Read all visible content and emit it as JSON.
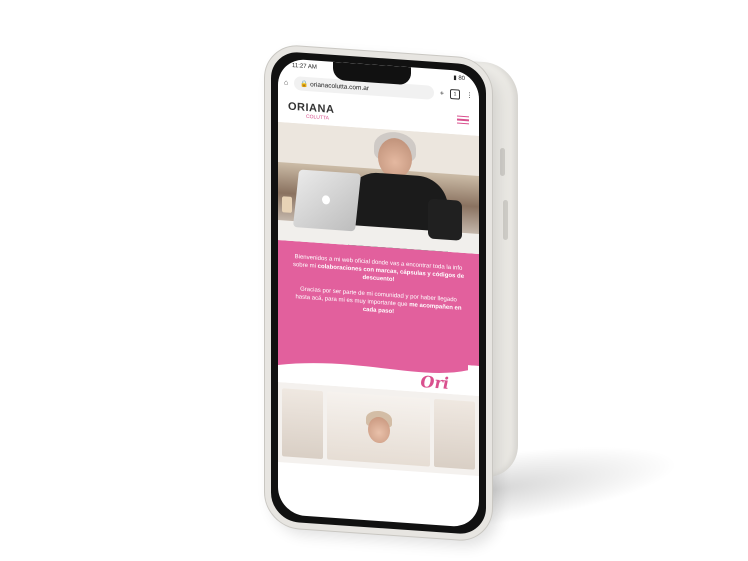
{
  "status": {
    "time": "11:27 AM",
    "battery": "80"
  },
  "browser": {
    "url": "orianacolutta.com.ar",
    "tab_count": "1"
  },
  "site": {
    "logo": "ORIANA",
    "logo_sub": "COLUTTA",
    "intro": "Bienvenidos a mi web oficial donde vas a encontrar toda la info sobre mi",
    "intro_bold": "colaboraciones con marcas, cápsulas y códigos de descuento!",
    "thanks": "Gracias por ser parte de mi comunidad y por haber llegado hasta acá,",
    "thanks2": "para mi es muy importante que",
    "thanks_bold": "me acompañen en cada paso!",
    "signature": "Ori"
  },
  "colors": {
    "brand_pink": "#e2609d",
    "frame": "#e7e5e1"
  }
}
